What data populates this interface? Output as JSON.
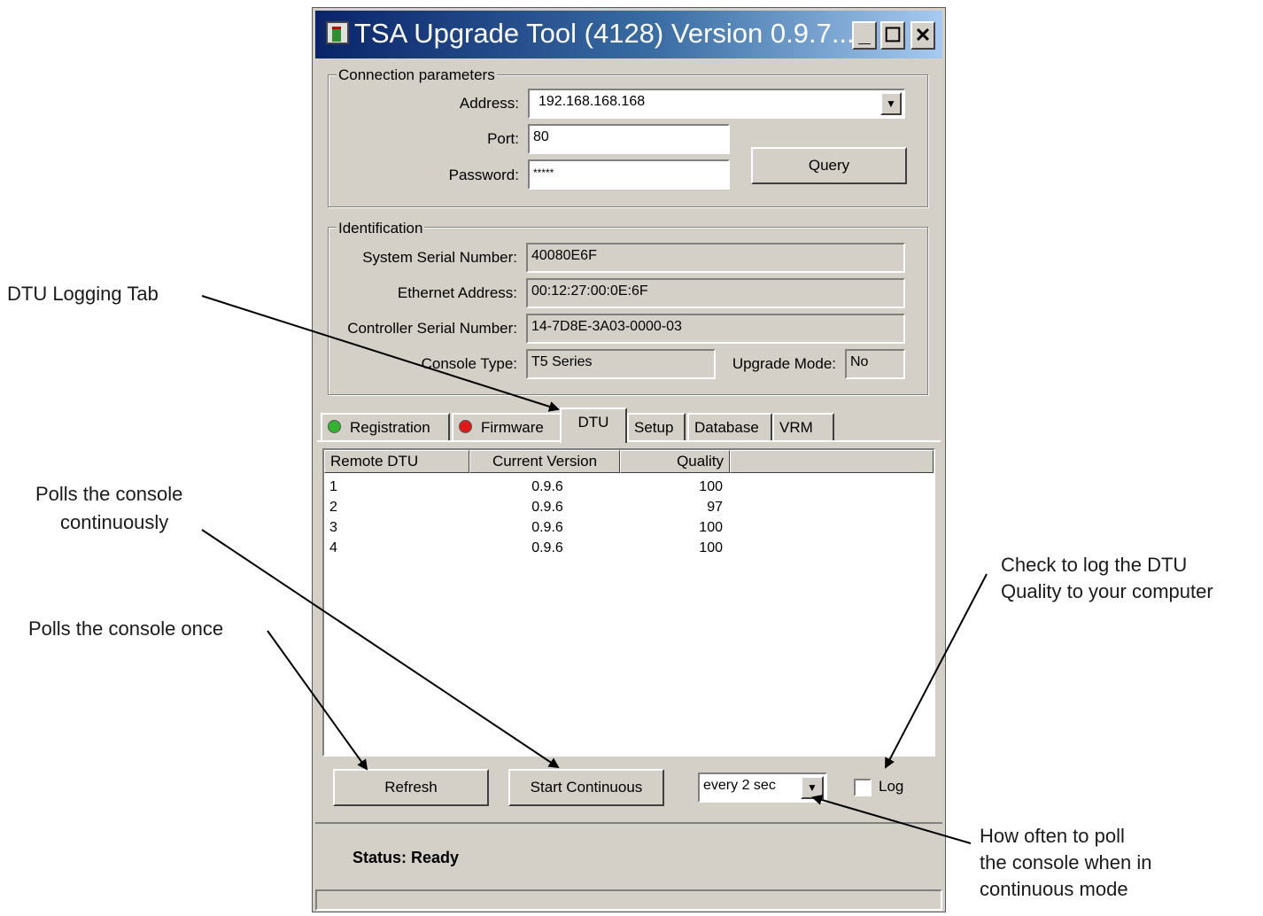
{
  "window": {
    "title": "TSA Upgrade Tool (4128) Version 0.9.7...",
    "controls": {
      "minimize": "_",
      "maximize": "☐",
      "close": "✕"
    }
  },
  "connection": {
    "group_label": "Connection parameters",
    "address_label": "Address:",
    "address_value": "192.168.168.168",
    "port_label": "Port:",
    "port_value": "80",
    "password_label": "Password:",
    "password_value": "*****",
    "query_button": "Query"
  },
  "identification": {
    "group_label": "Identification",
    "system_serial_label": "System Serial Number:",
    "system_serial_value": "40080E6F",
    "ethernet_label": "Ethernet Address:",
    "ethernet_value": "00:12:27:00:0E:6F",
    "controller_serial_label": "Controller Serial Number:",
    "controller_serial_value": "14-7D8E-3A03-0000-03",
    "console_type_label": "Console Type:",
    "console_type_value": "T5 Series",
    "upgrade_mode_label": "Upgrade Mode:",
    "upgrade_mode_value": "No"
  },
  "tabs": [
    {
      "label": "Registration",
      "status_color": "#2fb52f"
    },
    {
      "label": "Firmware",
      "status_color": "#e01818"
    },
    {
      "label": "DTU",
      "active": true
    },
    {
      "label": "Setup"
    },
    {
      "label": "Database"
    },
    {
      "label": "VRM"
    }
  ],
  "dtu_table": {
    "columns": [
      "Remote DTU",
      "Current Version",
      "Quality"
    ],
    "rows": [
      [
        "1",
        "0.9.6",
        "100"
      ],
      [
        "2",
        "0.9.6",
        "97"
      ],
      [
        "3",
        "0.9.6",
        "100"
      ],
      [
        "4",
        "0.9.6",
        "100"
      ]
    ]
  },
  "controls": {
    "refresh_button": "Refresh",
    "continuous_button": "Start Continuous",
    "interval_value": "every 2 sec",
    "log_label": "Log",
    "log_checked": false
  },
  "status": {
    "text": "Status: Ready"
  },
  "annotations": {
    "dtu_tab": "DTU Logging Tab",
    "continuous_line1": "Polls the console",
    "continuous_line2": "continuously",
    "once": "Polls the console once",
    "log_line1": "Check to log the DTU",
    "log_line2": "Quality to your computer",
    "interval_line1": "How often to poll",
    "interval_line2": "the console when in",
    "interval_line3": "continuous mode"
  }
}
